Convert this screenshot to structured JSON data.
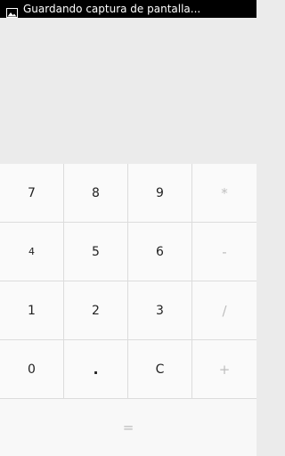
{
  "status_bar": {
    "notification_icon": "image-icon",
    "text": "Guardando captura de pantalla..."
  },
  "display": {
    "value": ""
  },
  "keypad": {
    "row1": [
      "7",
      "8",
      "9",
      "*"
    ],
    "row2": [
      "4",
      "5",
      "6",
      "-"
    ],
    "row3": [
      "1",
      "2",
      "3",
      "/"
    ],
    "row4": [
      "0",
      ".",
      "C",
      "+"
    ],
    "equals": "="
  },
  "colors": {
    "status_bar_bg": "#000000",
    "display_bg": "#ebebeb",
    "key_bg": "#fafafa",
    "operator_text": "#bdbdbd",
    "digit_text": "#222222"
  }
}
